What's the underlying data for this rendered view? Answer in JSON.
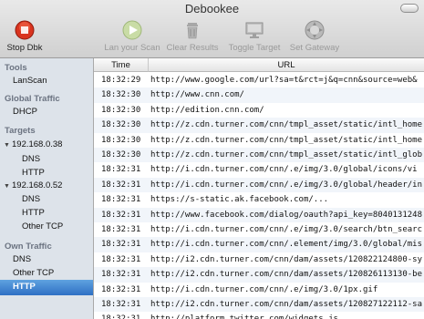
{
  "window": {
    "title": "Debookee"
  },
  "toolbar": {
    "stop": "Stop Dbk",
    "lan_scan": "Lan your Scan",
    "clear": "Clear Results",
    "toggle": "Toggle Target",
    "gateway": "Set Gateway"
  },
  "sidebar": {
    "tools_header": "Tools",
    "lanscan": "LanScan",
    "global_header": "Global Traffic",
    "dhcp": "DHCP",
    "targets_header": "Targets",
    "t1": "192.168.0.38",
    "t1_dns": "DNS",
    "t1_http": "HTTP",
    "t2": "192.168.0.52",
    "t2_dns": "DNS",
    "t2_http": "HTTP",
    "t2_other": "Other TCP",
    "own_header": "Own Traffic",
    "own_dns": "DNS",
    "own_other": "Other TCP",
    "own_http": "HTTP"
  },
  "table": {
    "headers": {
      "time": "Time",
      "url": "URL"
    },
    "rows": [
      {
        "time": "18:32:29",
        "url": "http://www.google.com/url?sa=t&rct=j&q=cnn&source=web&"
      },
      {
        "time": "18:32:30",
        "url": "http://www.cnn.com/"
      },
      {
        "time": "18:32:30",
        "url": "http://edition.cnn.com/"
      },
      {
        "time": "18:32:30",
        "url": "http://z.cdn.turner.com/cnn/tmpl_asset/static/intl_home"
      },
      {
        "time": "18:32:30",
        "url": "http://z.cdn.turner.com/cnn/tmpl_asset/static/intl_home"
      },
      {
        "time": "18:32:30",
        "url": "http://z.cdn.turner.com/cnn/tmpl_asset/static/intl_glob"
      },
      {
        "time": "18:32:31",
        "url": "http://i.cdn.turner.com/cnn/.e/img/3.0/global/icons/vi"
      },
      {
        "time": "18:32:31",
        "url": "http://i.cdn.turner.com/cnn/.e/img/3.0/global/header/in"
      },
      {
        "time": "18:32:31",
        "url": "https://s-static.ak.facebook.com/..."
      },
      {
        "time": "18:32:31",
        "url": "http://www.facebook.com/dialog/oauth?api_key=8040131248"
      },
      {
        "time": "18:32:31",
        "url": "http://i.cdn.turner.com/cnn/.e/img/3.0/search/btn_searc"
      },
      {
        "time": "18:32:31",
        "url": "http://i.cdn.turner.com/cnn/.element/img/3.0/global/mis"
      },
      {
        "time": "18:32:31",
        "url": "http://i2.cdn.turner.com/cnn/dam/assets/120822124800-sy"
      },
      {
        "time": "18:32:31",
        "url": "http://i2.cdn.turner.com/cnn/dam/assets/120826113130-be"
      },
      {
        "time": "18:32:31",
        "url": "http://i.cdn.turner.com/cnn/.e/img/3.0/1px.gif"
      },
      {
        "time": "18:32:31",
        "url": "http://i2.cdn.turner.com/cnn/dam/assets/120827122112-sa"
      },
      {
        "time": "18:32:31",
        "url": "http://platform.twitter.com/widgets.js"
      }
    ]
  }
}
